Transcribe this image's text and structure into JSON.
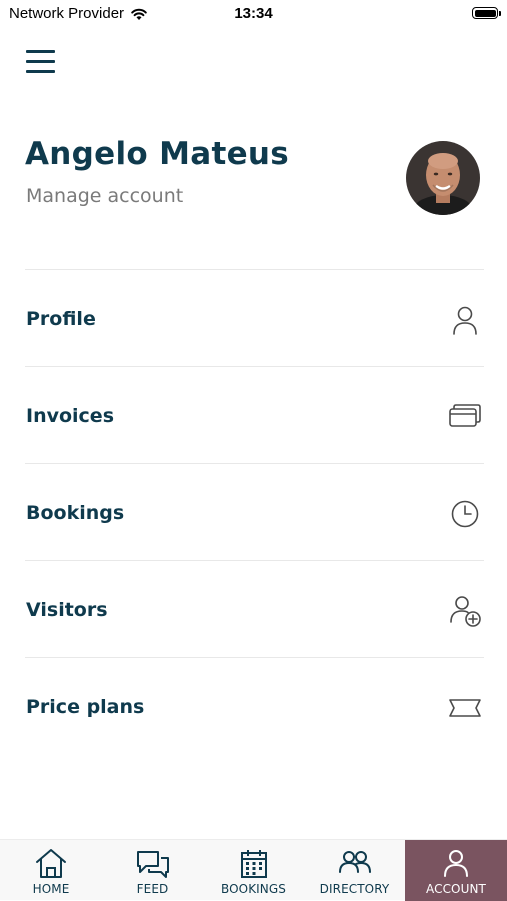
{
  "status_bar": {
    "carrier": "Network Provider",
    "time": "13:34"
  },
  "header": {
    "user_name": "Angelo Mateus",
    "manage_link": "Manage account"
  },
  "menu": {
    "items": [
      {
        "label": "Profile",
        "icon": "person-icon"
      },
      {
        "label": "Invoices",
        "icon": "cards-icon"
      },
      {
        "label": "Bookings",
        "icon": "clock-icon"
      },
      {
        "label": "Visitors",
        "icon": "add-person-icon"
      },
      {
        "label": "Price plans",
        "icon": "ticket-icon"
      }
    ]
  },
  "tab_bar": {
    "tabs": [
      {
        "label": "HOME",
        "icon": "home-icon"
      },
      {
        "label": "FEED",
        "icon": "chat-bubbles-icon"
      },
      {
        "label": "BOOKINGS",
        "icon": "calendar-icon"
      },
      {
        "label": "DIRECTORY",
        "icon": "people-icon"
      },
      {
        "label": "ACCOUNT",
        "icon": "person-icon",
        "active": true
      }
    ]
  },
  "colors": {
    "primary": "#0f3a4d",
    "muted_text": "#7a7a7a",
    "active_tab": "#7a5460",
    "divider": "#e8e8e8"
  }
}
